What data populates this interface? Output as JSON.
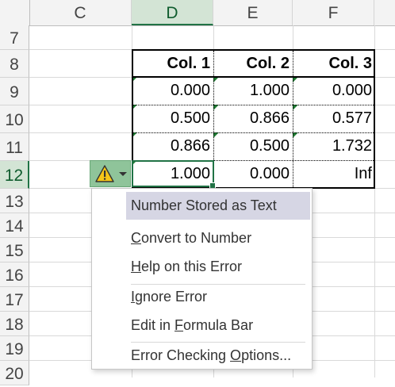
{
  "columns": [
    {
      "label": "C",
      "selected": false
    },
    {
      "label": "D",
      "selected": true
    },
    {
      "label": "E",
      "selected": false
    },
    {
      "label": "F",
      "selected": false
    }
  ],
  "rows": [
    "7",
    "8",
    "9",
    "10",
    "11",
    "12",
    "13",
    "14",
    "15",
    "16",
    "17",
    "18",
    "19",
    "20"
  ],
  "selected_row": "12",
  "table": {
    "headers": [
      "Col. 1",
      "Col. 2",
      "Col. 3"
    ],
    "data": [
      [
        "0.000",
        "1.000",
        "0.000"
      ],
      [
        "0.500",
        "0.866",
        "0.577"
      ],
      [
        "0.866",
        "0.500",
        "1.732"
      ],
      [
        "1.000",
        "0.000",
        "Inf"
      ]
    ]
  },
  "colors": {
    "error_indicator": "#1e7a32",
    "selection": "#217346",
    "smart_tag": "#8fc49a",
    "menu_title_bg": "#d6d6e4"
  },
  "smart_tag": {
    "icon": "warning-icon",
    "dropdown_icon": "chevron-down-icon"
  },
  "menu": {
    "title": "Number Stored as Text",
    "items": [
      {
        "before": "",
        "key": "C",
        "after": "onvert to Number"
      },
      {
        "before": "",
        "key": "H",
        "after": "elp on this Error"
      },
      {
        "before": "",
        "key": "I",
        "after": "gnore Error"
      },
      {
        "before": "Edit in ",
        "key": "F",
        "after": "ormula Bar"
      },
      {
        "before": "Error Checking ",
        "key": "O",
        "after": "ptions..."
      }
    ]
  }
}
